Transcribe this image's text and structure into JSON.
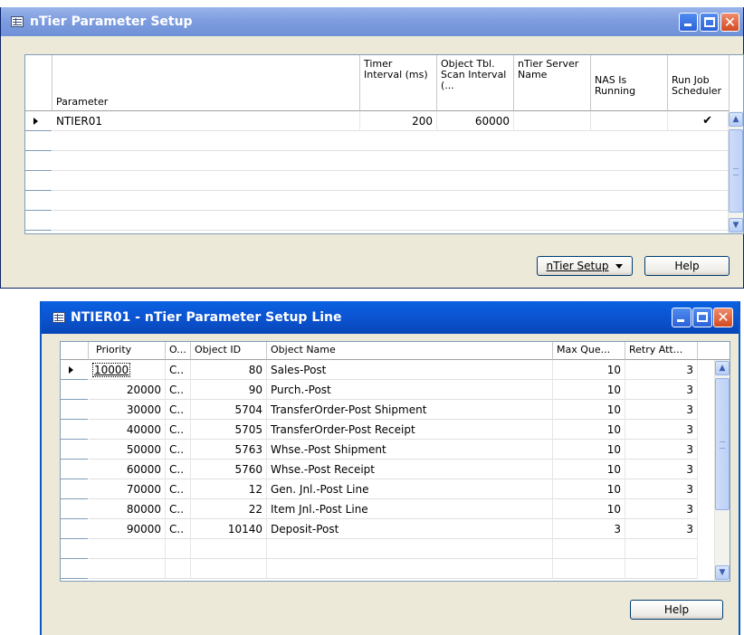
{
  "window1": {
    "title": "nTier Parameter Setup",
    "columns": [
      {
        "label": "Parameter"
      },
      {
        "label": "Timer Interval (ms)"
      },
      {
        "label": "Object Tbl. Scan Interval (..."
      },
      {
        "label": "nTier Server Name"
      },
      {
        "label": "NAS Is Running"
      },
      {
        "label": "Run Job Scheduler"
      }
    ],
    "rows": [
      {
        "parameter": "NTIER01",
        "timer": "200",
        "scan": "60000",
        "server": "",
        "nas": "",
        "run_job": "✔"
      }
    ],
    "setup_button": "nTier Setup",
    "help_button": "Help"
  },
  "window2": {
    "title": "NTIER01 - nTier Parameter Setup Line",
    "columns": [
      {
        "label": "Priority"
      },
      {
        "label": "O..."
      },
      {
        "label": "Object ID"
      },
      {
        "label": "Object Name"
      },
      {
        "label": "Max Que..."
      },
      {
        "label": "Retry Att..."
      }
    ],
    "rows": [
      {
        "priority": "10000",
        "type": "C..",
        "object_id": "80",
        "name": "Sales-Post",
        "max_queue": "10",
        "retry": "3"
      },
      {
        "priority": "20000",
        "type": "C..",
        "object_id": "90",
        "name": "Purch.-Post",
        "max_queue": "10",
        "retry": "3"
      },
      {
        "priority": "30000",
        "type": "C..",
        "object_id": "5704",
        "name": "TransferOrder-Post Shipment",
        "max_queue": "10",
        "retry": "3"
      },
      {
        "priority": "40000",
        "type": "C..",
        "object_id": "5705",
        "name": "TransferOrder-Post Receipt",
        "max_queue": "10",
        "retry": "3"
      },
      {
        "priority": "50000",
        "type": "C..",
        "object_id": "5763",
        "name": "Whse.-Post Shipment",
        "max_queue": "10",
        "retry": "3"
      },
      {
        "priority": "60000",
        "type": "C..",
        "object_id": "5760",
        "name": "Whse.-Post Receipt",
        "max_queue": "10",
        "retry": "3"
      },
      {
        "priority": "70000",
        "type": "C..",
        "object_id": "12",
        "name": "Gen. Jnl.-Post Line",
        "max_queue": "10",
        "retry": "3"
      },
      {
        "priority": "80000",
        "type": "C..",
        "object_id": "22",
        "name": "Item Jnl.-Post Line",
        "max_queue": "10",
        "retry": "3"
      },
      {
        "priority": "90000",
        "type": "C..",
        "object_id": "10140",
        "name": "Deposit-Post",
        "max_queue": "3",
        "retry": "3"
      }
    ],
    "help_button": "Help"
  },
  "colors": {
    "title_active": "#0a58c8",
    "title_inactive": "#7f9ddf",
    "window_bg": "#ece9d8",
    "close_btn": "#d24a22"
  }
}
